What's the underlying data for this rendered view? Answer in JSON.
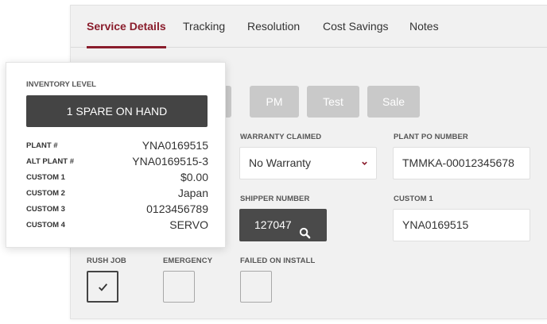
{
  "tabs": [
    {
      "label": "Service Details",
      "active": true
    },
    {
      "label": "Tracking",
      "active": false
    },
    {
      "label": "Resolution",
      "active": false
    },
    {
      "label": "Cost Savings",
      "active": false
    },
    {
      "label": "Notes",
      "active": false
    }
  ],
  "service_types": [
    "PM",
    "Test",
    "Sale"
  ],
  "fields": {
    "warranty_claimed": {
      "label": "WARRANTY CLAIMED",
      "value": "No Warranty",
      "caret_icon": "chevron-down-icon"
    },
    "plant_po_number": {
      "label": "PLANT PO NUMBER",
      "value": "TMMKA-00012345678"
    },
    "shipper_number": {
      "label": "SHIPPER NUMBER",
      "value": "127047",
      "icon": "search-icon"
    },
    "custom_1": {
      "label": "CUSTOM 1",
      "value": "YNA0169515"
    }
  },
  "flags": {
    "rush_job": {
      "label": "RUSH JOB",
      "checked": true
    },
    "emergency": {
      "label": "EMERGENCY",
      "checked": false
    },
    "failed_on_install": {
      "label": "FAILED ON INSTALL",
      "checked": false
    }
  },
  "inventory": {
    "title": "INVENTORY LEVEL",
    "status": "1 SPARE ON HAND",
    "rows": [
      {
        "key": "PLANT #",
        "value": "YNA0169515"
      },
      {
        "key": "ALT PLANT #",
        "value": "YNA0169515-3"
      },
      {
        "key": "CUSTOM 1",
        "value": "$0.00"
      },
      {
        "key": "CUSTOM 2",
        "value": "Japan"
      },
      {
        "key": "CUSTOM 3",
        "value": "0123456789"
      },
      {
        "key": "CUSTOM 4",
        "value": "SERVO"
      }
    ]
  },
  "colors": {
    "accent": "#8a1d2c",
    "dark_button": "#444444",
    "chip_disabled": "#c9c9c9",
    "panel_bg": "#f1f1f1"
  }
}
